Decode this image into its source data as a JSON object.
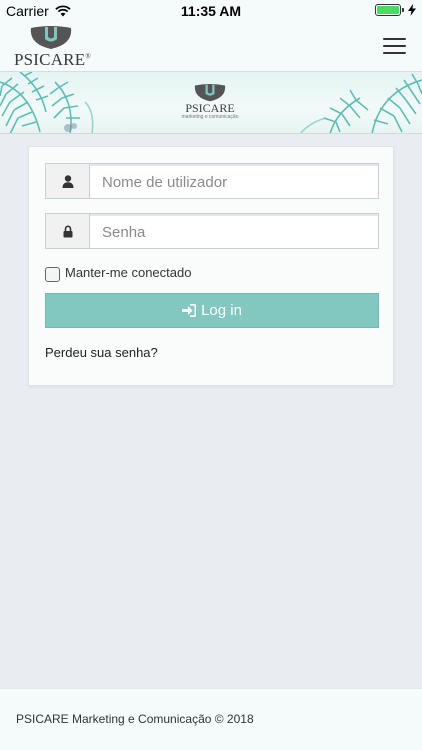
{
  "status_bar": {
    "carrier": "Carrier",
    "time": "11:35 AM",
    "battery_color": "#4cd964"
  },
  "header": {
    "brand_name": "PSICARE",
    "brand_registered": "®",
    "menu_icon": "hamburger-icon"
  },
  "banner": {
    "brand_name": "PSICARE",
    "tagline": "marketing e comunicação"
  },
  "login": {
    "username_placeholder": "Nome de utilizador",
    "username_icon": "user-icon",
    "password_placeholder": "Senha",
    "password_icon": "lock-icon",
    "remember_label": "Manter-me conectado",
    "remember_checked": false,
    "submit_label": "Log in",
    "submit_icon": "sign-in-icon",
    "lost_password": "Perdeu sua senha?",
    "accent_color": "#82c8c0"
  },
  "footer": {
    "copyright": "PSICARE Marketing e Comunicação © 2018"
  }
}
